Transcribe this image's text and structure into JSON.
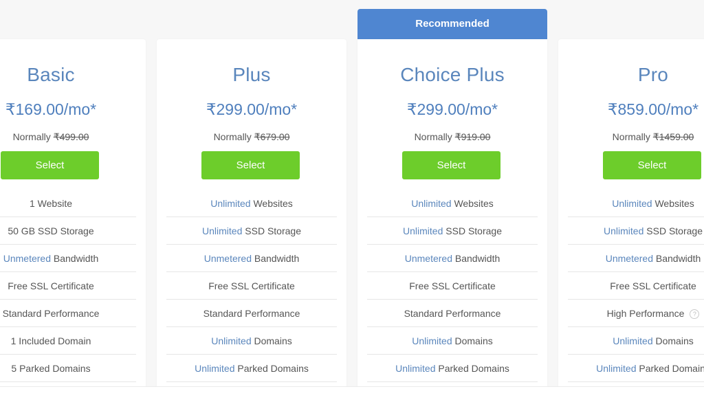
{
  "recommended_label": "Recommended",
  "select_label": "Select",
  "normally_label": "Normally",
  "plans": [
    {
      "name": "Basic",
      "price": "₹169.00/mo*",
      "normal_price": "₹499.00",
      "features": [
        {
          "highlight": "",
          "text": "1 Website"
        },
        {
          "highlight": "",
          "text": "50 GB SSD Storage"
        },
        {
          "highlight": "Unmetered",
          "text": " Bandwidth"
        },
        {
          "highlight": "",
          "text": "Free SSL Certificate"
        },
        {
          "highlight": "",
          "text": "Standard Performance"
        },
        {
          "highlight": "",
          "text": "1 Included Domain"
        },
        {
          "highlight": "",
          "text": "5 Parked Domains"
        }
      ]
    },
    {
      "name": "Plus",
      "price": "₹299.00/mo*",
      "normal_price": "₹679.00",
      "features": [
        {
          "highlight": "Unlimited",
          "text": " Websites"
        },
        {
          "highlight": "Unlimited",
          "text": " SSD Storage"
        },
        {
          "highlight": "Unmetered",
          "text": " Bandwidth"
        },
        {
          "highlight": "",
          "text": "Free SSL Certificate"
        },
        {
          "highlight": "",
          "text": "Standard Performance"
        },
        {
          "highlight": "Unlimited",
          "text": " Domains"
        },
        {
          "highlight": "Unlimited",
          "text": " Parked Domains"
        }
      ]
    },
    {
      "name": "Choice Plus",
      "price": "₹299.00/mo*",
      "normal_price": "₹919.00",
      "recommended": true,
      "features": [
        {
          "highlight": "Unlimited",
          "text": " Websites"
        },
        {
          "highlight": "Unlimited",
          "text": " SSD Storage"
        },
        {
          "highlight": "Unmetered",
          "text": " Bandwidth"
        },
        {
          "highlight": "",
          "text": "Free SSL Certificate"
        },
        {
          "highlight": "",
          "text": "Standard Performance"
        },
        {
          "highlight": "Unlimited",
          "text": " Domains"
        },
        {
          "highlight": "Unlimited",
          "text": " Parked Domains"
        }
      ]
    },
    {
      "name": "Pro",
      "price": "₹859.00/mo*",
      "normal_price": "₹1459.00",
      "features": [
        {
          "highlight": "Unlimited",
          "text": " Websites"
        },
        {
          "highlight": "Unlimited",
          "text": " SSD Storage"
        },
        {
          "highlight": "Unmetered",
          "text": " Bandwidth"
        },
        {
          "highlight": "",
          "text": "Free SSL Certificate"
        },
        {
          "highlight": "",
          "text": "High Performance",
          "help_icon": "?"
        },
        {
          "highlight": "Unlimited",
          "text": " Domains"
        },
        {
          "highlight": "Unlimited",
          "text": " Parked Domains"
        }
      ]
    }
  ],
  "colors": {
    "accent_blue": "#4f86d1",
    "price_blue": "#4f7fbd",
    "select_green": "#6dcd2b"
  }
}
